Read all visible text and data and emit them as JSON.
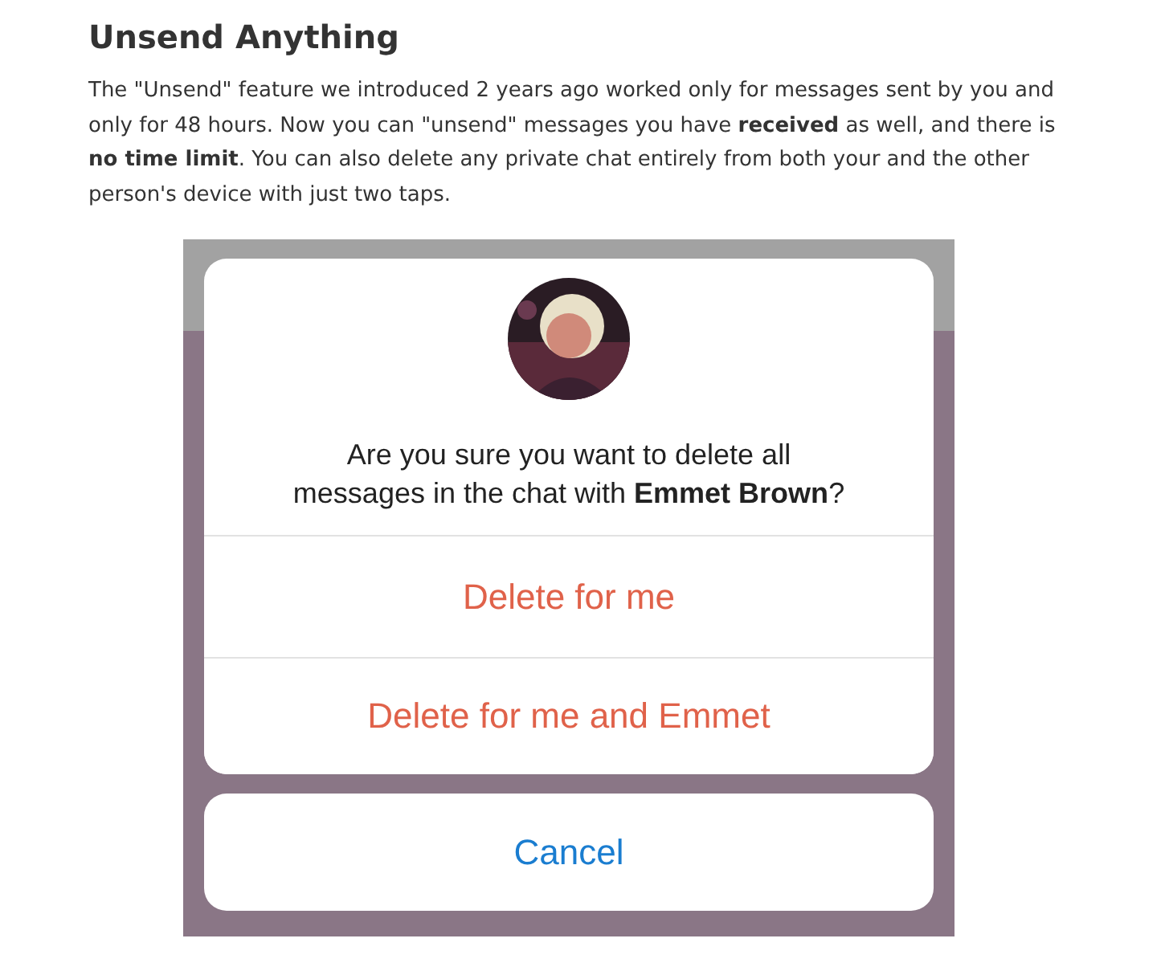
{
  "article": {
    "heading": "Unsend Anything",
    "paragraph": "The \"Unsend\" feature we introduced 2 years ago worked only for messages sent by you and only for 48 hours. Now you can \"unsend\" messages you have **received** as well, and there is **no time limit**. You can also delete any private chat entirely from both your and the other person's device with just two taps."
  },
  "dialog": {
    "message": "Are you sure you want to delete all messages in the chat with **Emmet Brown**?",
    "actions": [
      {
        "label": "Delete for me",
        "kind": "destructive"
      },
      {
        "label": "Delete for me and Emmet",
        "kind": "destructive"
      }
    ],
    "cancel": {
      "label": "Cancel",
      "kind": "cancel"
    }
  }
}
